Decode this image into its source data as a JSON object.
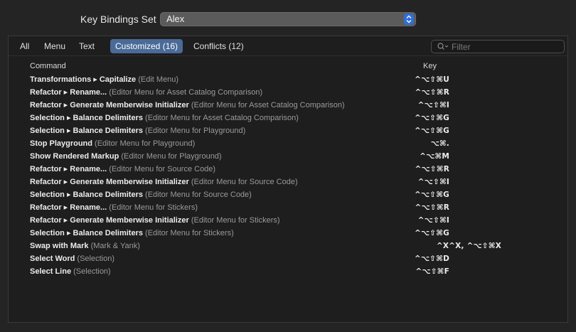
{
  "header": {
    "set_label": "Key Bindings Set",
    "set_value": "Alex"
  },
  "tabs": [
    {
      "label": "All"
    },
    {
      "label": "Menu"
    },
    {
      "label": "Text"
    },
    {
      "label": "Customized (16)",
      "active": true
    },
    {
      "label": "Conflicts (12)"
    }
  ],
  "filter": {
    "placeholder": "Filter"
  },
  "columns": {
    "command": "Command",
    "key": "Key"
  },
  "rows": [
    {
      "name": "Transformations ▸ Capitalize",
      "context": " (Edit Menu)",
      "key": "^⌥⇧⌘U"
    },
    {
      "name": "Refactor ▸ Rename...",
      "context": " (Editor Menu for Asset Catalog Comparison)",
      "key": "^⌥⇧⌘R"
    },
    {
      "name": "Refactor ▸ Generate Memberwise Initializer",
      "context": " (Editor Menu for Asset Catalog Comparison)",
      "key": "^⌥⇧⌘I"
    },
    {
      "name": "Selection ▸ Balance Delimiters",
      "context": " (Editor Menu for Asset Catalog Comparison)",
      "key": "^⌥⇧⌘G"
    },
    {
      "name": "Selection ▸ Balance Delimiters",
      "context": " (Editor Menu for Playground)",
      "key": "^⌥⇧⌘G"
    },
    {
      "name": "Stop Playground",
      "context": " (Editor Menu for Playground)",
      "key": "⌥⌘."
    },
    {
      "name": "Show Rendered Markup",
      "context": " (Editor Menu for Playground)",
      "key": "^⌥⌘M"
    },
    {
      "name": "Refactor ▸ Rename...",
      "context": " (Editor Menu for Source Code)",
      "key": "^⌥⇧⌘R"
    },
    {
      "name": "Refactor ▸ Generate Memberwise Initializer",
      "context": " (Editor Menu for Source Code)",
      "key": "^⌥⇧⌘I"
    },
    {
      "name": "Selection ▸ Balance Delimiters",
      "context": " (Editor Menu for Source Code)",
      "key": "^⌥⇧⌘G"
    },
    {
      "name": "Refactor ▸ Rename...",
      "context": " (Editor Menu for Stickers)",
      "key": "^⌥⇧⌘R"
    },
    {
      "name": "Refactor ▸ Generate Memberwise Initializer",
      "context": " (Editor Menu for Stickers)",
      "key": "^⌥⇧⌘I"
    },
    {
      "name": "Selection ▸ Balance Delimiters",
      "context": " (Editor Menu for Stickers)",
      "key": "^⌥⇧⌘G"
    },
    {
      "name": "Swap with Mark",
      "context": " (Mark & Yank)",
      "key": "^X^X, ^⌥⇧⌘X",
      "wide": true
    },
    {
      "name": "Select Word",
      "context": " (Selection)",
      "key": "^⌥⇧⌘D"
    },
    {
      "name": "Select Line",
      "context": " (Selection)",
      "key": "^⌥⇧⌘F"
    }
  ]
}
